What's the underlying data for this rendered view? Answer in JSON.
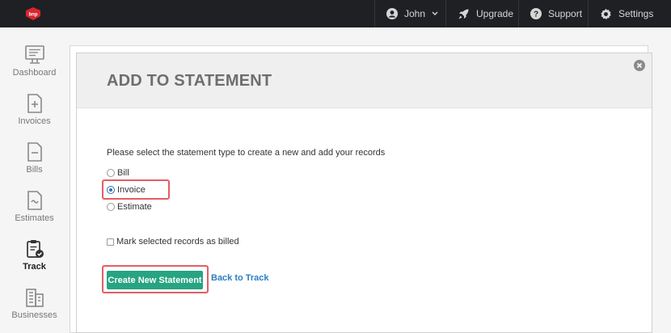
{
  "topbar": {
    "logo_text": "bnp",
    "user_label": "John",
    "upgrade_label": "Upgrade",
    "support_label": "Support",
    "settings_label": "Settings"
  },
  "sidebar": {
    "items": [
      {
        "label": "Dashboard",
        "icon": "monitor-icon"
      },
      {
        "label": "Invoices",
        "icon": "document-plus-icon"
      },
      {
        "label": "Bills",
        "icon": "document-minus-icon"
      },
      {
        "label": "Estimates",
        "icon": "document-approx-icon"
      },
      {
        "label": "Track",
        "icon": "clipboard-check-icon",
        "active": true
      },
      {
        "label": "Businesses",
        "icon": "buildings-icon"
      }
    ]
  },
  "modal": {
    "title": "ADD TO STATEMENT",
    "prompt": "Please select the statement type to create a new and add your records",
    "options": [
      {
        "label": "Bill",
        "checked": false
      },
      {
        "label": "Invoice",
        "checked": true
      },
      {
        "label": "Estimate",
        "checked": false
      }
    ],
    "mark_billed_label": "Mark selected records as billed",
    "mark_billed_checked": false,
    "create_button": "Create New Statement",
    "back_link": "Back to Track"
  },
  "colors": {
    "topbar": "#1f2024",
    "primary_button": "#27a481",
    "link": "#2a7ec4",
    "highlight": "#e45d63",
    "logo": "#d9262e"
  }
}
